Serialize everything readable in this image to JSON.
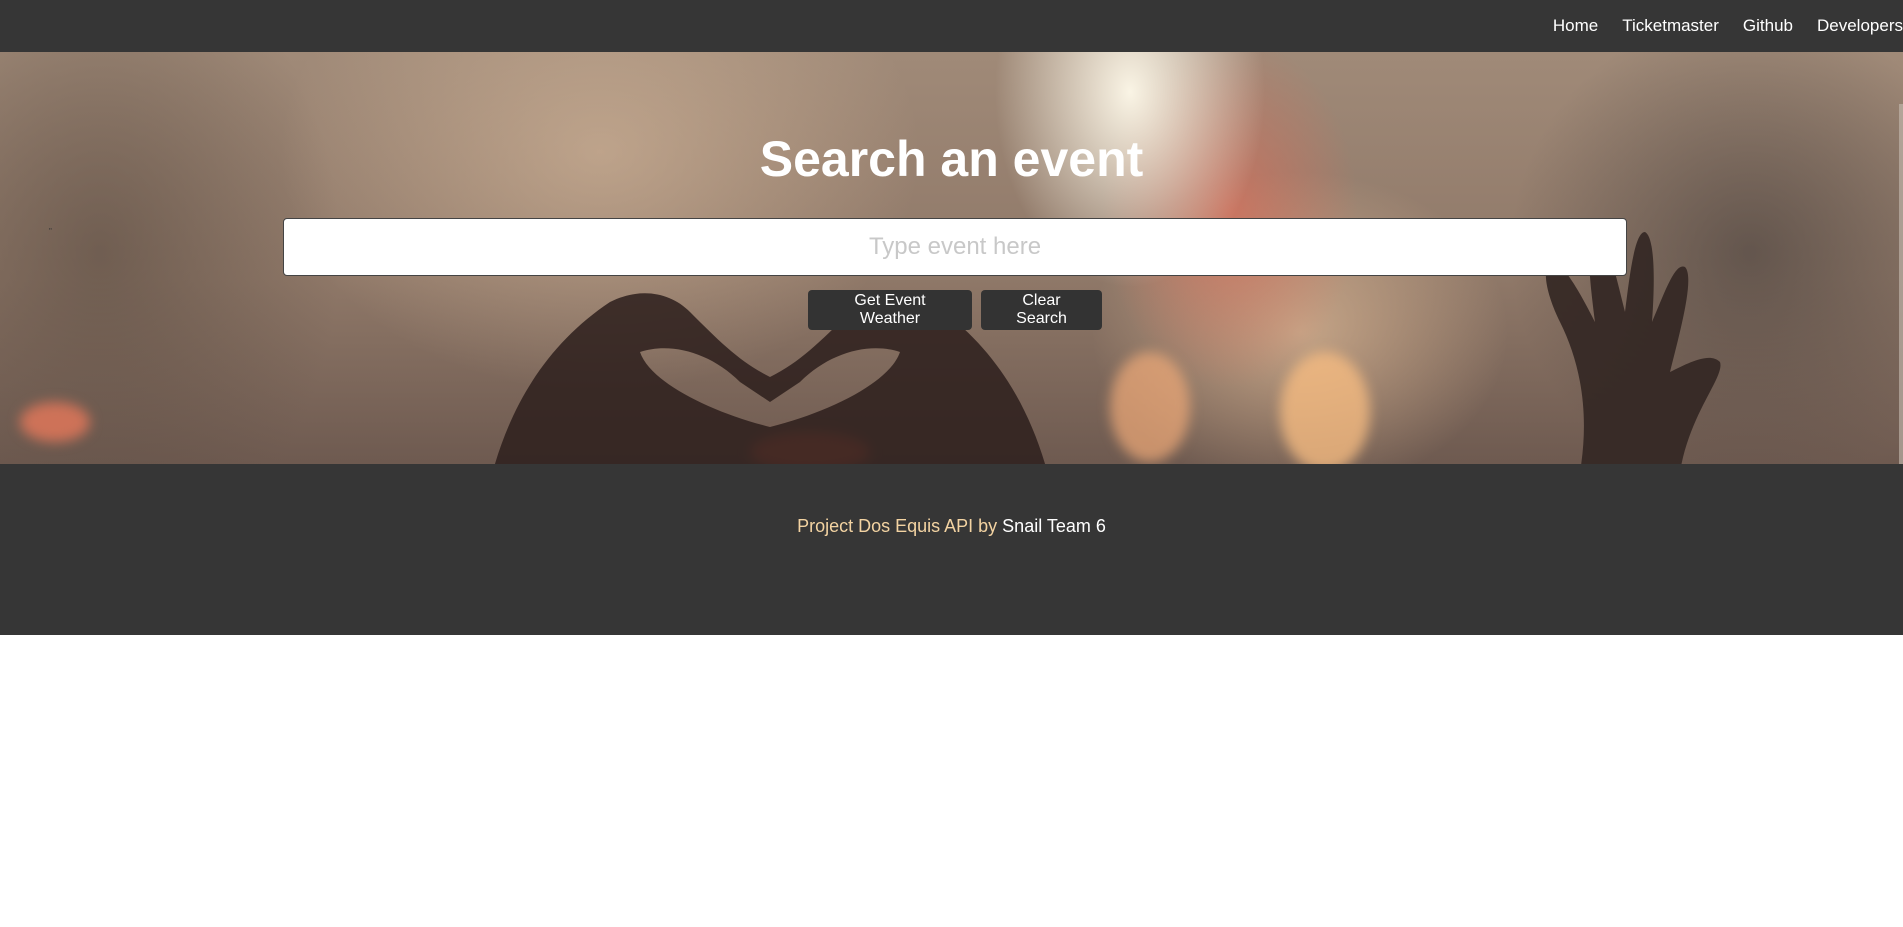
{
  "navbar": {
    "links": [
      {
        "label": "Home"
      },
      {
        "label": "Ticketmaster"
      },
      {
        "label": "Github"
      },
      {
        "label": "Developers"
      }
    ]
  },
  "hero": {
    "title": "Search an event",
    "search": {
      "placeholder": "Type event here",
      "value": ""
    },
    "buttons": {
      "weather_label": "Get Event Weather",
      "clear_label": "Clear Search"
    }
  },
  "footer": {
    "project_text": "Project Dos Equis API by ",
    "team_link": "Snail Team 6"
  },
  "colors": {
    "navbar_bg": "#363636",
    "button_bg": "#333333",
    "footer_accent": "#f3d3a2"
  }
}
